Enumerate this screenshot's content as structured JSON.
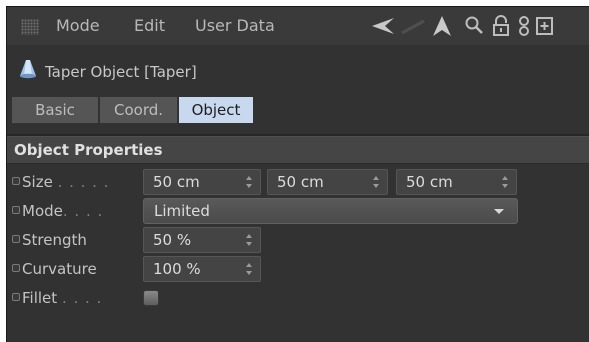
{
  "menu": {
    "items": [
      {
        "label": "Mode"
      },
      {
        "label": "Edit"
      },
      {
        "label": "User Data"
      }
    ],
    "tools": [
      "back-arrow-icon",
      "forward-arrow-icon",
      "up-arrow-icon",
      "search-icon",
      "lock-icon",
      "link-icon",
      "new-panel-icon"
    ]
  },
  "object": {
    "icon": "taper-object-icon",
    "title": "Taper Object [Taper]"
  },
  "tabs": [
    {
      "label": "Basic",
      "active": false
    },
    {
      "label": "Coord.",
      "active": false
    },
    {
      "label": "Object",
      "active": true
    }
  ],
  "section": {
    "title": "Object Properties"
  },
  "properties": {
    "size": {
      "label": "Size",
      "dots": ". . . . .",
      "values": [
        "50 cm",
        "50 cm",
        "50 cm"
      ]
    },
    "mode": {
      "label": "Mode",
      "dots": ". . . .",
      "value": "Limited"
    },
    "strength": {
      "label": "Strength",
      "value": "50 %"
    },
    "curvature": {
      "label": "Curvature",
      "value": "100 %"
    },
    "fillet": {
      "label": "Fillet",
      "dots": ". . . .",
      "checked": false
    }
  },
  "colors": {
    "panel_bg": "#323232",
    "active_tab": "#c8d8ee",
    "accent_icon": "#a9c8ee"
  }
}
